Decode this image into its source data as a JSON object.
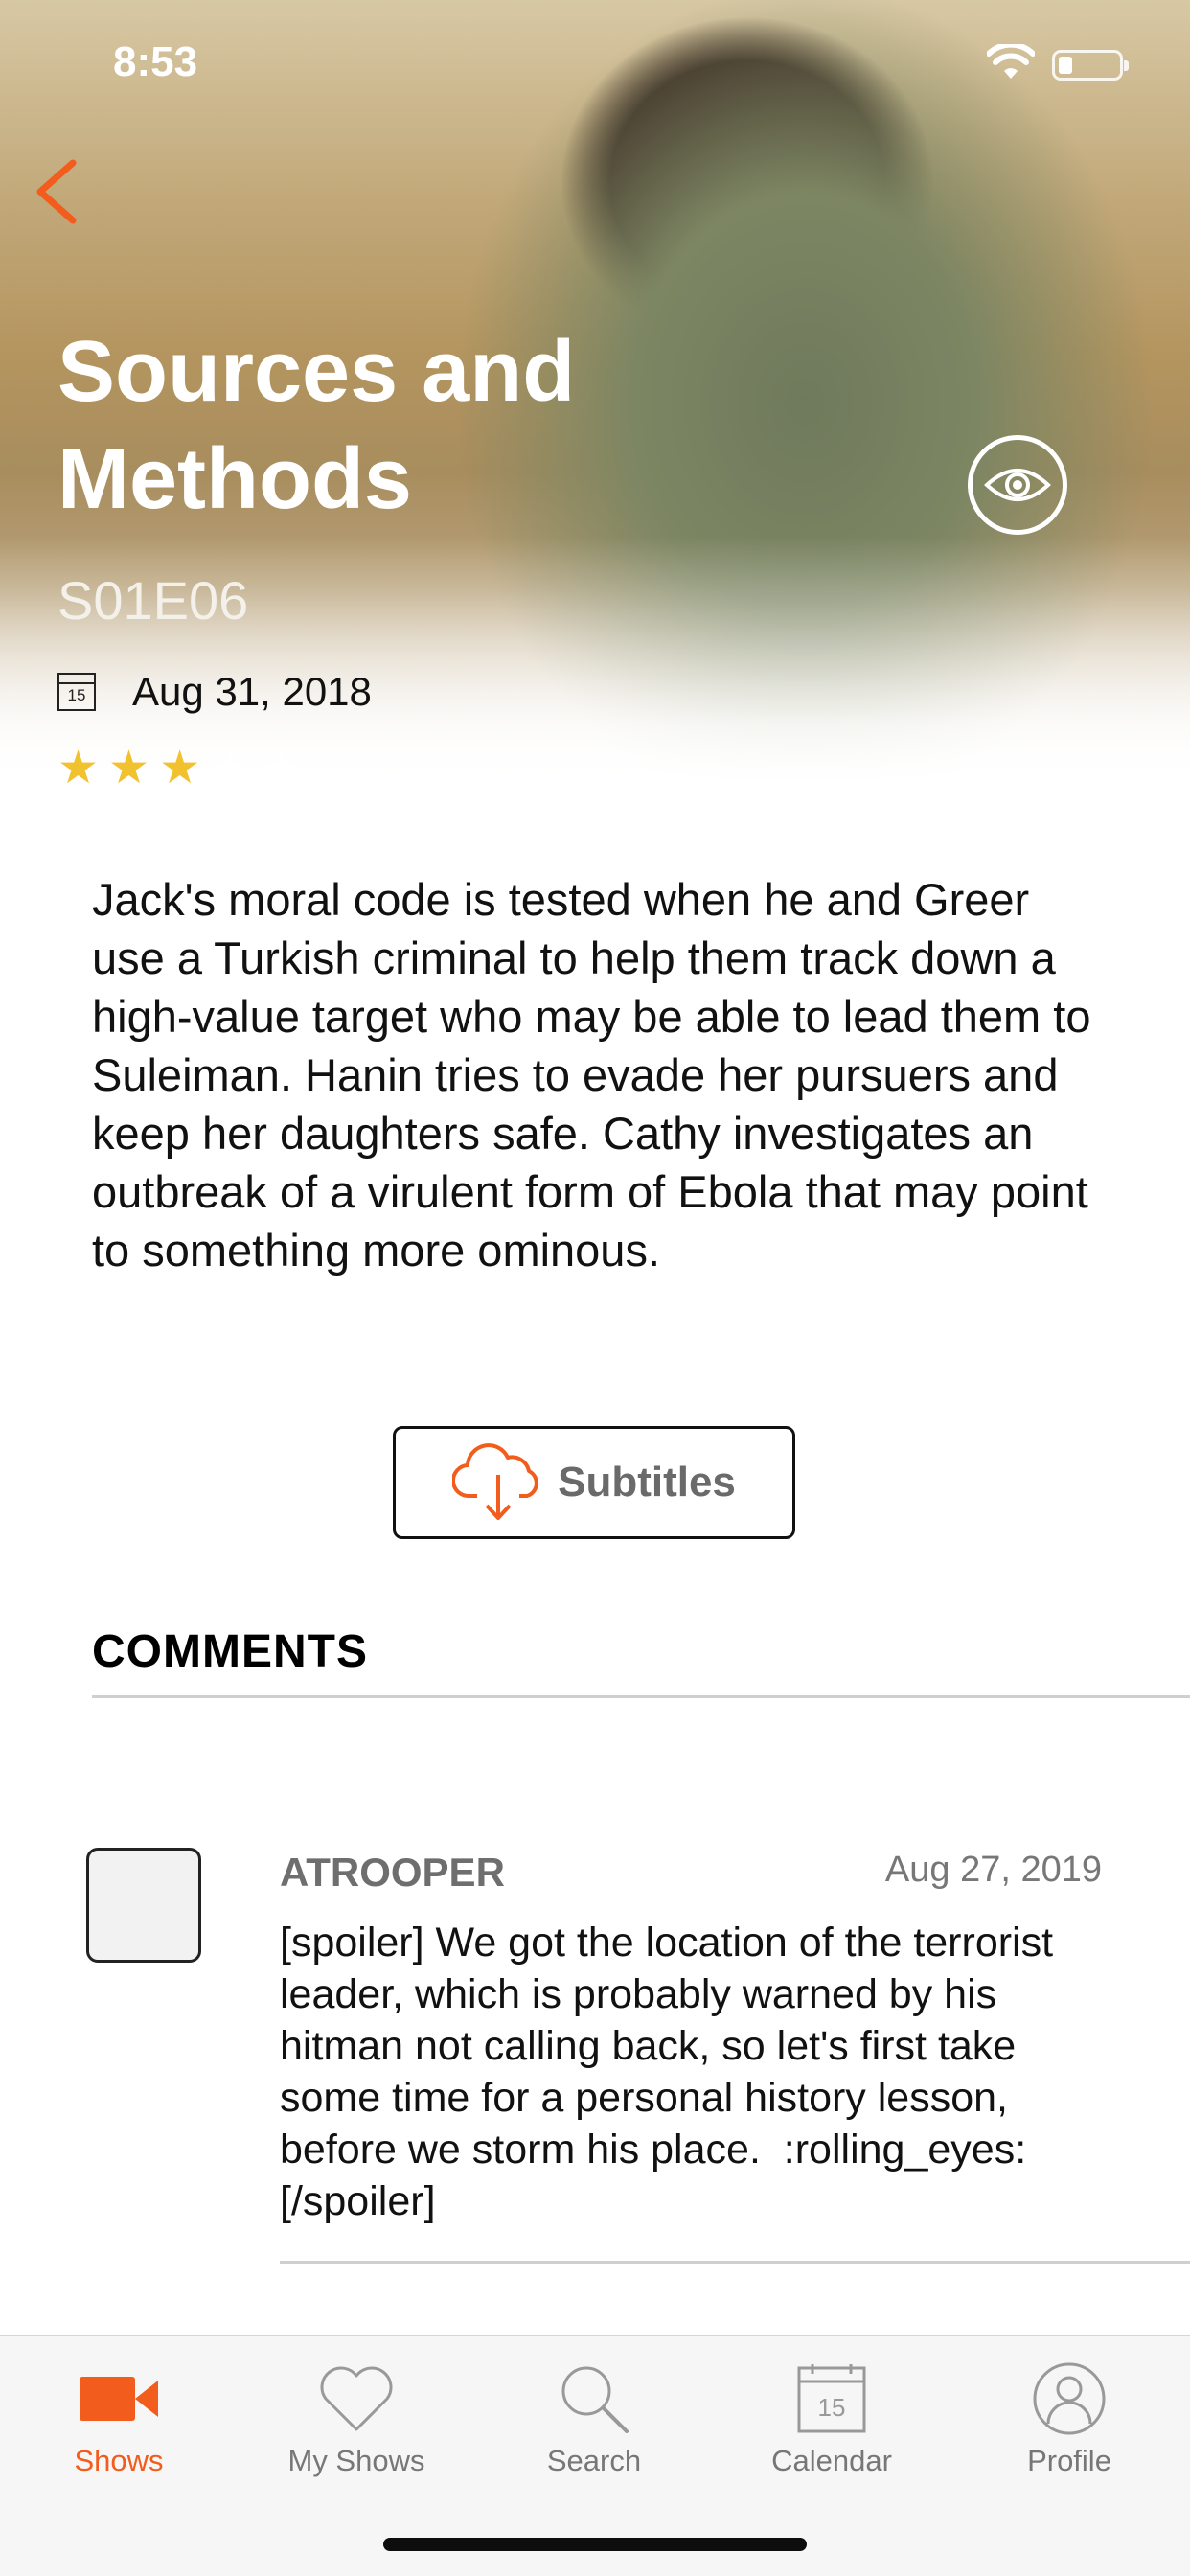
{
  "status_bar": {
    "time": "8:53"
  },
  "episode": {
    "title": "Sources and Methods",
    "code": "S01E06",
    "air_date": "Aug 31, 2018",
    "calendar_icon_day": "15",
    "rating": {
      "value": 3,
      "max": 5
    },
    "description": "Jack's moral code is tested when he and Greer use a Turkish criminal to help them track down a high-value target who may be able to lead them to Suleiman. Hanin tries to evade her pursuers and keep her daughters safe. Cathy investigates an outbreak of a virulent form of Ebola that may point to something more ominous."
  },
  "actions": {
    "subtitles_label": "Subtitles"
  },
  "comments": {
    "heading": "COMMENTS",
    "items": [
      {
        "user": "ATROOPER",
        "date": "Aug 27, 2019",
        "text": "[spoiler] We got the location of the terrorist leader, which is probably warned by his hitman not calling back, so let's first take some time for a personal history lesson, before we storm his place.  :rolling_eyes:   [/spoiler]"
      }
    ]
  },
  "tab_bar": {
    "items": [
      {
        "label": "Shows",
        "icon": "video-camera-icon",
        "active": true
      },
      {
        "label": "My Shows",
        "icon": "heart-icon",
        "active": false
      },
      {
        "label": "Search",
        "icon": "search-icon",
        "active": false
      },
      {
        "label": "Calendar",
        "icon": "calendar-icon",
        "active": false,
        "icon_text": "15"
      },
      {
        "label": "Profile",
        "icon": "profile-icon",
        "active": false
      }
    ]
  },
  "colors": {
    "accent": "#f25c1c",
    "star": "#f2c12e",
    "inactive": "#777777"
  }
}
